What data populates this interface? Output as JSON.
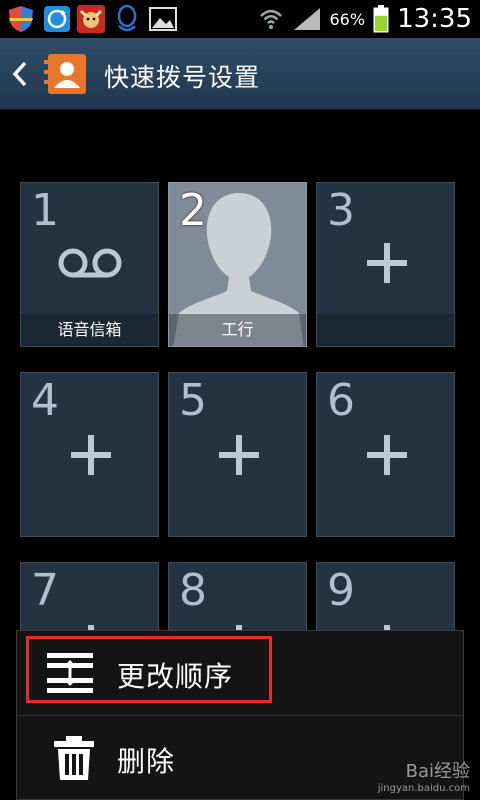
{
  "status_bar": {
    "battery_percent": "66%",
    "time": "13:35",
    "notification_icons": [
      "shield-icon",
      "refresh-icon",
      "bull-app-icon",
      "qq-icon",
      "gallery-icon"
    ],
    "battery_level": 0.66
  },
  "header": {
    "title": "快速拨号设置"
  },
  "tiles": [
    {
      "num": "1",
      "label": "语音信箱",
      "kind": "voicemail"
    },
    {
      "num": "2",
      "label": "工行",
      "kind": "contact"
    },
    {
      "num": "3",
      "label": "",
      "kind": "empty"
    },
    {
      "num": "4",
      "label": "",
      "kind": "empty"
    },
    {
      "num": "5",
      "label": "",
      "kind": "empty"
    },
    {
      "num": "6",
      "label": "",
      "kind": "empty"
    },
    {
      "num": "7",
      "label": "",
      "kind": "empty"
    },
    {
      "num": "8",
      "label": "",
      "kind": "empty"
    },
    {
      "num": "9",
      "label": "",
      "kind": "empty"
    }
  ],
  "menu": {
    "items": [
      {
        "label": "更改顺序",
        "icon": "reorder-icon"
      },
      {
        "label": "删除",
        "icon": "trash-icon"
      }
    ]
  },
  "watermark": {
    "brand": "Bai经验",
    "url": "jingyan.baidu.com"
  },
  "colors": {
    "header": "#2a4660",
    "tile": "#243342",
    "highlight": "#e52b2b",
    "battery": "#9ad62a"
  }
}
